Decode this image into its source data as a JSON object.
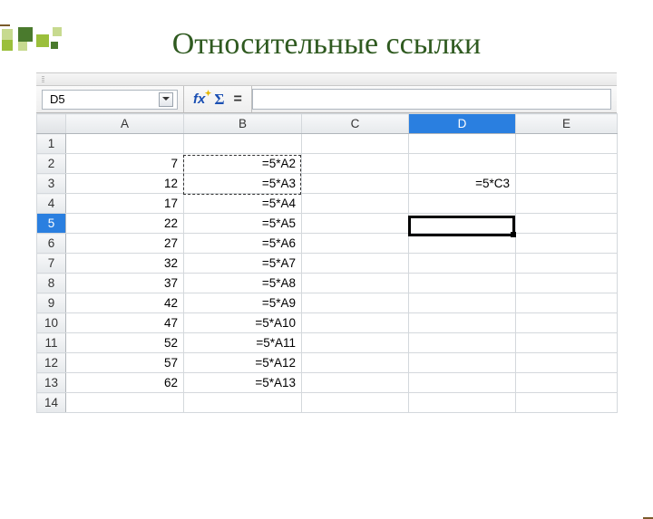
{
  "slide_title": "Относительные ссылки",
  "formula_bar": {
    "name_box": "D5",
    "icons": {
      "fx": "fx",
      "sigma": "Σ",
      "eq": "="
    },
    "input_value": ""
  },
  "columns": [
    "A",
    "B",
    "C",
    "D",
    "E"
  ],
  "rows_count": 14,
  "selection": {
    "col": "D",
    "row": 5
  },
  "cells": {
    "A2": "7",
    "B2": "=5*A2",
    "A3": "12",
    "B3": "=5*A3",
    "D3": "=5*C3",
    "A4": "17",
    "B4": "=5*A4",
    "A5": "22",
    "B5": "=5*A5",
    "A6": "27",
    "B6": "=5*A6",
    "A7": "32",
    "B7": "=5*A7",
    "A8": "37",
    "B8": "=5*A8",
    "A9": "42",
    "B9": "=5*A9",
    "A10": "47",
    "B10": "=5*A10",
    "A11": "52",
    "B11": "=5*A11",
    "A12": "57",
    "B12": "=5*A12",
    "A13": "62",
    "B13": "=5*A13"
  }
}
